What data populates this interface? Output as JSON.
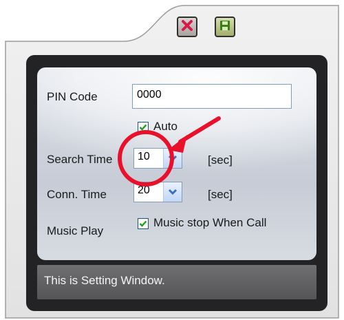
{
  "window": {
    "close_icon": "close-x-icon",
    "save_icon": "save-disk-icon"
  },
  "settings": {
    "pin_label": "PIN Code",
    "pin_value": "0000",
    "auto_label": "Auto",
    "auto_checked": true,
    "search_time_label": "Search Time",
    "search_time_value": "10",
    "search_time_unit": "[sec]",
    "conn_time_label": "Conn. Time",
    "conn_time_value": "20",
    "conn_time_unit": "[sec]",
    "music_play_label": "Music Play",
    "music_stop_label": "Music stop When Call",
    "music_stop_checked": true
  },
  "status": {
    "text": "This is Setting Window."
  },
  "colors": {
    "frame": "#232325",
    "annotation_red": "#e8102a",
    "combo_arrow": "#3b6fc4"
  }
}
